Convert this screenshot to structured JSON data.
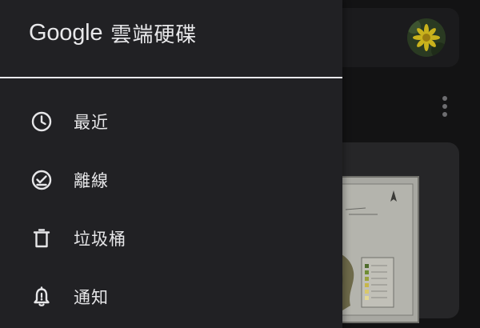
{
  "drawer": {
    "title_brand": "Google",
    "title_product": "雲端硬碟",
    "items": [
      {
        "icon": "clock-icon",
        "label": "最近"
      },
      {
        "icon": "offline-icon",
        "label": "離線"
      },
      {
        "icon": "trash-icon",
        "label": "垃圾桶"
      },
      {
        "icon": "bell-icon",
        "label": "通知"
      }
    ]
  },
  "background": {
    "avatar": "account-avatar",
    "more": "more-vert-icon",
    "thumbnail": "map-thumbnail"
  },
  "colors": {
    "drawer_bg": "#212124",
    "text": "#e6e6e8",
    "divider": "#e9e9ec",
    "page_bg": "#131314"
  }
}
